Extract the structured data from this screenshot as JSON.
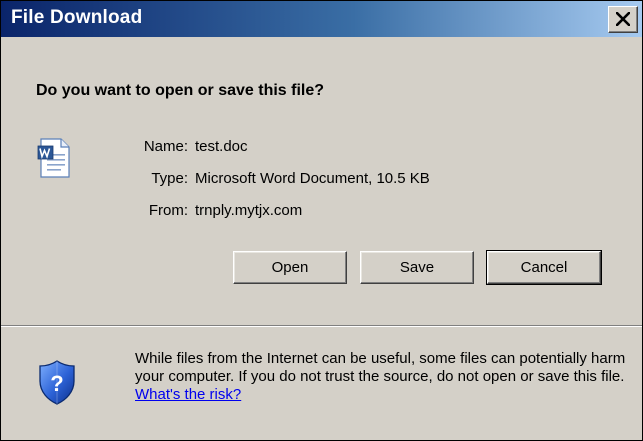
{
  "dialog": {
    "title": "File Download",
    "close_glyph": "✕",
    "question": "Do you want to open or save this file?",
    "file_icon": "word-document-icon",
    "fields": [
      {
        "label": "Name:",
        "value": "test.doc"
      },
      {
        "label": "Type:",
        "value": "Microsoft Word Document, 10.5 KB"
      },
      {
        "label": "From:",
        "value": "trnply.mytjx.com"
      }
    ],
    "buttons": {
      "open": "Open",
      "save": "Save",
      "cancel": "Cancel"
    },
    "warning_icon": "shield-question-icon",
    "warning_text": "While files from the Internet can be useful, some files can potentially harm your computer. If you do not trust the source, do not open or save this file.",
    "risk_link": "What's the risk?"
  },
  "colors": {
    "titlebar_start": "#0a246a",
    "titlebar_end": "#a6caf0",
    "face": "#d4d0c8",
    "link": "#0000ee"
  }
}
